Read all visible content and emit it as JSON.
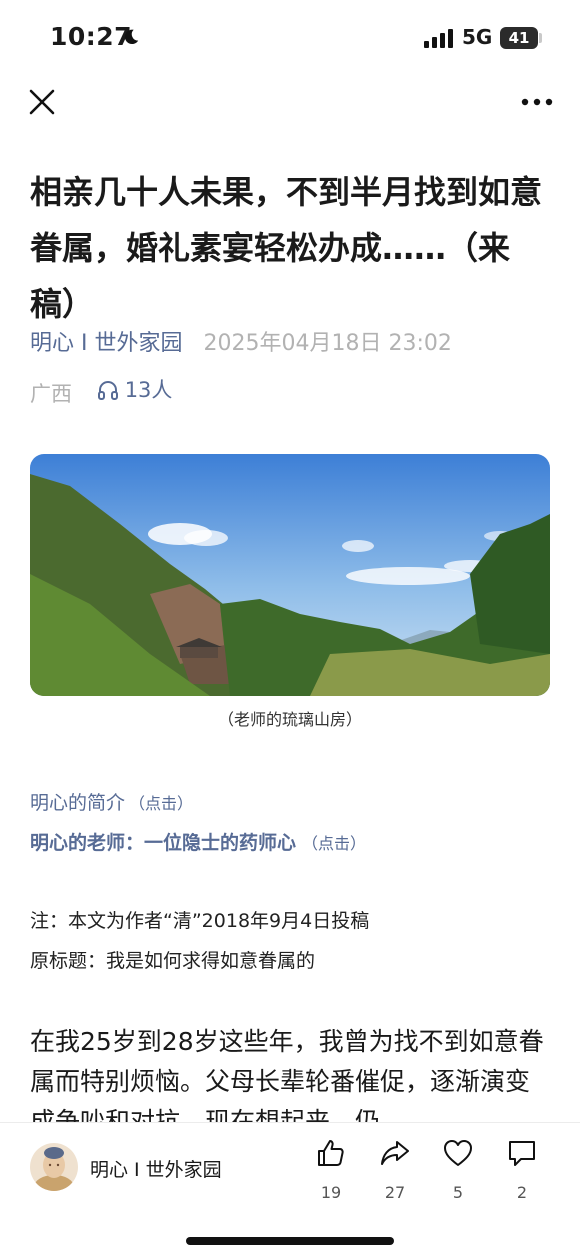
{
  "status_bar": {
    "time": "10:27",
    "network": "5G",
    "battery": "41"
  },
  "nav": {
    "close_icon": "close-icon",
    "more_icon": "more-dots-icon"
  },
  "article": {
    "title": "相亲几十人未果，不到半月找到如意眷属，婚礼素宴轻松办成……（来稿）",
    "account": "明心 I 世外家园",
    "date": "2025年04月18日 23:02",
    "region": "广西",
    "listeners": "13人",
    "image_caption": "（老师的琉璃山房）",
    "intro_link": "明心的简介",
    "intro_hint": "（点击）",
    "teacher_link": "明心的老师：一位隐士的药师心",
    "teacher_hint": "（点击）",
    "note1": "注：本文为作者“清”2018年9月4日投稿",
    "note2": "原标题：我是如何求得如意眷属的",
    "body": "在我25岁到28岁这些年，我曾为找不到如意眷属而特别烦恼。父母长辈轮番催促，逐渐演变成争吵和对抗。现在想起来，仍"
  },
  "bottom_bar": {
    "account": "明心 I 世外家园",
    "like_count": "19",
    "share_count": "27",
    "heart_count": "5",
    "comment_count": "2"
  },
  "colors": {
    "link": "#576b95",
    "meta": "#b2b2b2",
    "text": "#1a1a1a"
  }
}
